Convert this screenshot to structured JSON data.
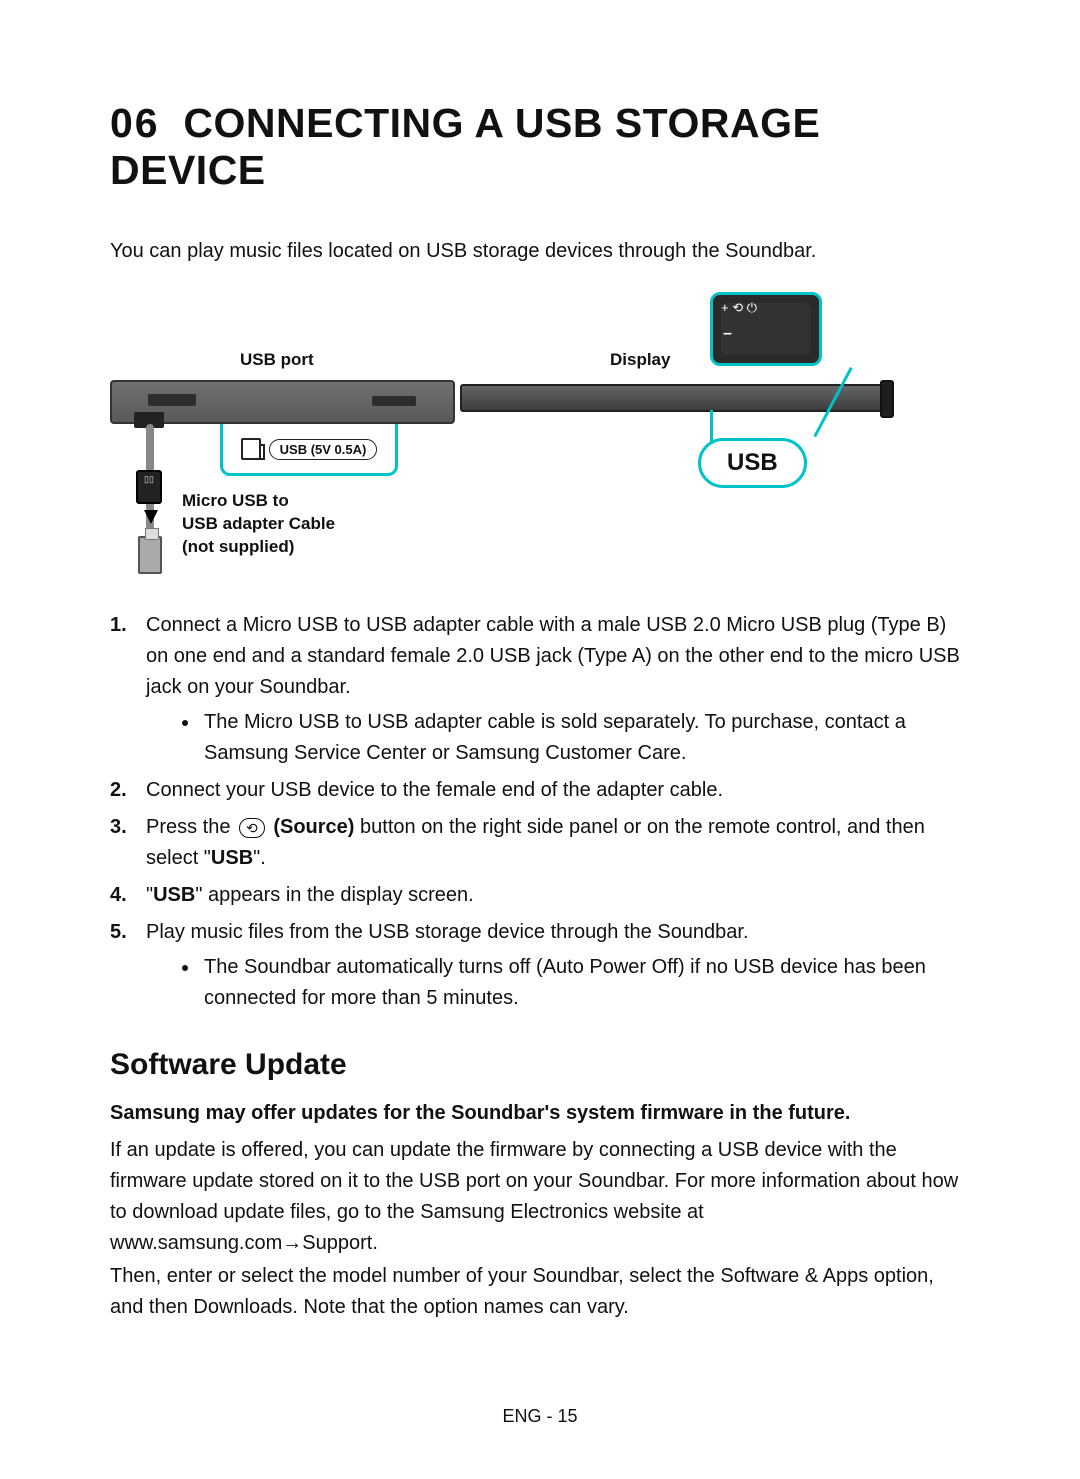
{
  "heading": {
    "num": "06",
    "title": "CONNECTING A USB STORAGE DEVICE"
  },
  "intro": "You can play music files located on USB storage devices through the Soundbar.",
  "diagram": {
    "usb_port_label": "USB port",
    "display_label": "Display",
    "usb_callout": "USB",
    "port_text": "USB (5V 0.5A)",
    "cable_label_l1": "Micro USB to",
    "cable_label_l2": "USB adapter Cable",
    "cable_label_l3": "(not supplied)",
    "remote_glyphs": "+  ⟲  ⏻"
  },
  "steps": {
    "s1": "Connect a Micro USB to USB adapter cable with a male USB 2.0 Micro USB plug (Type B) on one end and a standard female 2.0 USB jack (Type A) on the other end to the micro USB jack on your Soundbar.",
    "s1_bullet": "The Micro USB to USB adapter cable is sold separately. To purchase, contact a Samsung Service Center or Samsung Customer Care.",
    "s2": "Connect your USB device to the female end of the adapter cable.",
    "s3_a": "Press the ",
    "s3_icon": "⟲",
    "s3_source": "(Source)",
    "s3_b": " button on the right side panel or on the remote control, and then select \"",
    "s3_usb": "USB",
    "s3_c": "\".",
    "s4_a": "\"",
    "s4_usb": "USB",
    "s4_b": "\" appears in the display screen.",
    "s5": "Play music files from the USB storage device through the Soundbar.",
    "s5_bullet": "The Soundbar automatically turns off (Auto Power Off) if no USB device has been connected for more than 5 minutes."
  },
  "software": {
    "heading": "Software Update",
    "lead": "Samsung may offer updates for the Soundbar's system firmware in the future.",
    "p1": "If an update is offered, you can update the firmware by connecting a USB device with the firmware update stored on it to the USB port on your Soundbar. For more information about how to download update files, go to the Samsung Electronics website at www.samsung.com→Support.",
    "p2": "Then, enter or select the model number of your Soundbar, select the Software & Apps option, and then Downloads. Note that the option names can vary."
  },
  "footer": "ENG - 15"
}
